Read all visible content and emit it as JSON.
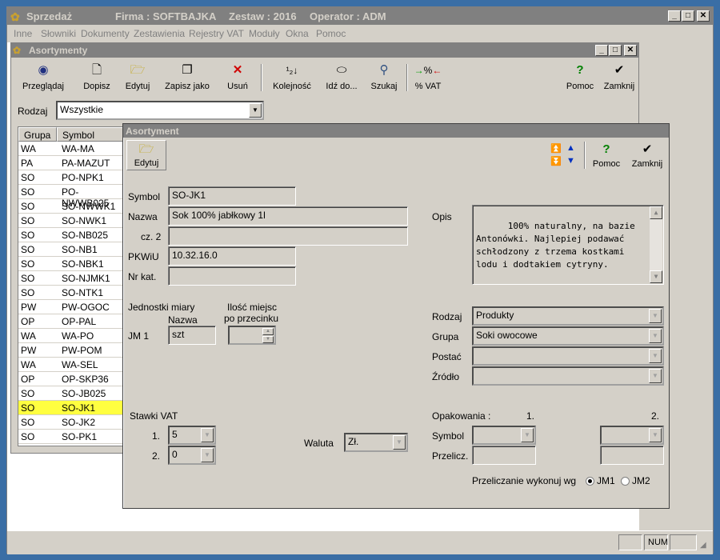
{
  "app": {
    "title": "Sprzedaż",
    "firma": "Firma : SOFTBAJKA",
    "zestaw": "Zestaw : 2016",
    "operator": "Operator : ADM"
  },
  "menu": [
    "Inne",
    "Słowniki",
    "Dokumenty",
    "Zestawienia",
    "Rejestry VAT",
    "Moduły",
    "Okna",
    "Pomoc"
  ],
  "list_window": {
    "title": "Asortymenty",
    "toolbar": [
      "Przeglądaj",
      "Dopisz",
      "Edytuj",
      "Zapisz jako",
      "Usuń",
      "Kolejność",
      "Idź do...",
      "Szukaj",
      "% VAT",
      "Pomoc",
      "Zamknij"
    ],
    "rodzaj_label": "Rodzaj",
    "rodzaj_value": "Wszystkie",
    "grid": {
      "headers": [
        "Grupa",
        "Symbol"
      ],
      "rows": [
        [
          "WA",
          "WA-MA"
        ],
        [
          "PA",
          "PA-MAZUT"
        ],
        [
          "SO",
          "PO-NPK1"
        ],
        [
          "SO",
          "PO-NWWB025"
        ],
        [
          "SO",
          "SO-NWWK1"
        ],
        [
          "SO",
          "SO-NWK1"
        ],
        [
          "SO",
          "SO-NB025"
        ],
        [
          "SO",
          "SO-NB1"
        ],
        [
          "SO",
          "SO-NBK1"
        ],
        [
          "SO",
          "SO-NJMK1"
        ],
        [
          "SO",
          "SO-NTK1"
        ],
        [
          "PW",
          "PW-OGOC"
        ],
        [
          "OP",
          "OP-PAL"
        ],
        [
          "WA",
          "WA-PO"
        ],
        [
          "PW",
          "PW-POM"
        ],
        [
          "WA",
          "WA-SEL"
        ],
        [
          "OP",
          "OP-SKP36"
        ],
        [
          "SO",
          "SO-JB025"
        ],
        [
          "SO",
          "SO-JK1"
        ],
        [
          "SO",
          "SO-JK2"
        ],
        [
          "SO",
          "SO-PK1"
        ]
      ],
      "selected_index": 18
    }
  },
  "detail": {
    "title": "Asortyment",
    "edytuj": "Edytuj",
    "pomoc": "Pomoc",
    "zamknij": "Zamknij",
    "labels": {
      "symbol": "Symbol",
      "nazwa": "Nazwa",
      "cz2": "cz. 2",
      "pkwiu": "PKWiU",
      "nrkat": "Nr kat.",
      "opis": "Opis",
      "jm_title": "Jednostki miary",
      "jm_nazwa": "Nazwa",
      "ilosc1": "Ilość miejsc",
      "ilosc2": "po przecinku",
      "jm1": "JM 1",
      "rodzaj": "Rodzaj",
      "grupa": "Grupa",
      "postac": "Postać",
      "zrodlo": "Źródło",
      "stawki": "Stawki VAT",
      "s1": "1.",
      "s2": "2.",
      "waluta": "Waluta",
      "opakowania": "Opakowania :",
      "op1": "1.",
      "op2": "2.",
      "op_symbol": "Symbol",
      "op_przelicz": "Przelicz.",
      "przeliczanie": "Przeliczanie wykonuj wg",
      "jm1_radio": "JM1",
      "jm2_radio": "JM2"
    },
    "values": {
      "symbol": "SO-JK1",
      "nazwa": "Sok 100% jabłkowy 1l",
      "cz2": "",
      "pkwiu": "10.32.16.0",
      "nrkat": "",
      "opis": "100% naturalny, na bazie\nAntonówki. Najlepiej podawać\nschłodzony z trzema kostkami\nlodu i dodtakiem cytryny.",
      "jm1": "szt",
      "rodzaj": "Produkty",
      "grupa": "Soki owocowe",
      "stawka1": "5",
      "stawka2": "0",
      "waluta": "Zł.",
      "radio_selected": "JM1"
    }
  },
  "status": {
    "num": "NUM"
  }
}
